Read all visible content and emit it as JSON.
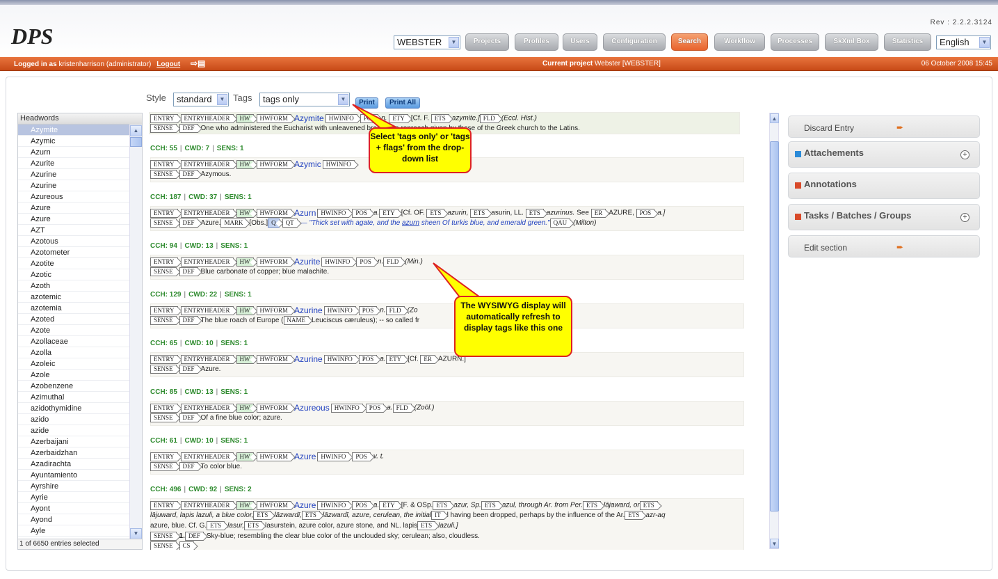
{
  "app": {
    "logo": "DPS",
    "rev": "Rev : 2.2.2.3124",
    "dictionary": "WEBSTER",
    "language": "English"
  },
  "nav": [
    "Projects",
    "Profiles",
    "Users",
    "Configuration",
    "Search",
    "Workflow",
    "Processes",
    "SkXml Box",
    "Statistics"
  ],
  "userbar": {
    "logged_label": "Logged in as",
    "user": "kristenharrison (administrator)",
    "logout": "Logout",
    "project_label": "Current project",
    "project": "Webster [WEBSTER]",
    "date": "06 October 2008 15:45"
  },
  "toolbar": {
    "style_label": "Style",
    "style_value": "standard",
    "tags_label": "Tags",
    "tags_value": "tags only",
    "print": "Print",
    "print_all": "Print All"
  },
  "headwords": {
    "title": "Headwords",
    "footer": "1 of 6650 entries selected",
    "items": [
      "Azymite",
      "Azymic",
      "Azurn",
      "Azurite",
      "Azurine",
      "Azurine",
      "Azureous",
      "Azure",
      "Azure",
      "AZT",
      "Azotous",
      "Azotometer",
      "Azotite",
      "Azotic",
      "Azoth",
      "azotemic",
      "azotemia",
      "Azoted",
      "Azote",
      "Azollaceae",
      "Azolla",
      "Azoleic",
      "Azole",
      "Azobenzene",
      "Azimuthal",
      "azidothymidine",
      "azido",
      "azide",
      "Azerbaijani",
      "Azerbaidzhan",
      "Azadirachta",
      "Ayuntamiento",
      "Ayrshire",
      "Ayrie",
      "Ayont",
      "Ayond",
      "Ayle"
    ]
  },
  "entries": [
    {
      "stats": "",
      "hw": "Azymite",
      "line1": "[Cf. F.",
      "ets": "azymite.]",
      "fld": "(Eccl. Hist.)",
      "def": "One who administered the Eucharist with unleavened bread; -- a reproach given by those of the Greek church to the Latins."
    },
    {
      "stats": [
        "CCH: 55",
        "CWD: 7",
        "SENS: 1"
      ],
      "hw": "Azymic",
      "def": "Azymous."
    },
    {
      "stats": [
        "CCH: 187",
        "CWD: 37",
        "SENS: 1"
      ],
      "hw": "Azurn",
      "pos": "a.",
      "l1a": "[Cf. OF.",
      "l1b": "azurin,",
      "l1c": "asurin, LL.",
      "l1d": "azurinus.",
      "l1e": "See",
      "l1f": "AZURE,",
      "l1g": "a.]",
      "def": "Azure.",
      "obs": "[Obs.]",
      "quote": "— \"Thick set with agate, and the",
      "quoteb": "azurn",
      "quotec": "sheen Of turkis blue, and emerald green.\"",
      "auth": "(Milton)"
    },
    {
      "stats": [
        "CCH: 94",
        "CWD: 13",
        "SENS: 1"
      ],
      "hw": "Azurite",
      "pos": "n.",
      "fld": "(Min.)",
      "def": "Blue carbonate of copper; blue malachite."
    },
    {
      "stats": [
        "CCH: 129",
        "CWD: 22",
        "SENS: 1"
      ],
      "hw": "Azurine",
      "pos": "n.",
      "fld": "(Zo",
      "def": "The blue roach of Europe (",
      "defb": "Leuciscus cæruleus); -- so called fr"
    },
    {
      "stats": [
        "CCH: 65",
        "CWD: 10",
        "SENS: 1"
      ],
      "hw": "Azurine",
      "pos": "a.",
      "l1": "[Cf.",
      "l1b": "AZURN.]",
      "def": "Azure."
    },
    {
      "stats": [
        "CCH: 85",
        "CWD: 13",
        "SENS: 1"
      ],
      "hw": "Azureous",
      "pos": "a.",
      "fld": "(Zoöl.)",
      "def": "Of a fine blue color; azure."
    },
    {
      "stats": [
        "CCH: 61",
        "CWD: 10",
        "SENS: 1"
      ],
      "hw": "Azure",
      "pos": "v. t.",
      "def": "To color blue."
    },
    {
      "stats": [
        "CCH: 496",
        "CWD: 92",
        "SENS: 2"
      ],
      "hw": "Azure",
      "pos": "a.",
      "a": "[F. & OSp.",
      "b": "azur, Sp.",
      "c": "azul, through Ar. from Per.",
      "d": "lājaward, or",
      "e": "lājuward, lapis lazuli, a blue color,",
      "f": "lāzwardī,",
      "g": "lāzwardī, azure, cerulean, the initial",
      "h": "l having been dropped, perhaps by the influence of the Ar.",
      "i": "azr-aq",
      "j": "azure, blue. Cf. G.",
      "k": "lasur,",
      "l": "lasurstein, azure color, azure stone, and NL. lapis",
      "m": "lazuli.]",
      "n": "1.",
      "o": "Sky-blue; resembling the clear blue color of the unclouded sky; cerulean; also, cloudless."
    }
  ],
  "tags": {
    "entry": "ENTRY",
    "entryheader": "ENTRYHEADER",
    "hw": "HW",
    "hwform": "HWFORM",
    "hwinfo": "HWINFO",
    "pos": "POS",
    "ety": "ETY",
    "ets": "ETS",
    "fld": "FLD",
    "sense": "SENSE",
    "def": "DEF",
    "mark": "MARK",
    "q": "Q",
    "qt": "QT",
    "qau": "QAU",
    "er": "ER",
    "name": "NAME",
    "it": "IT",
    "cs": "CS"
  },
  "right": {
    "discard": "Discard Entry",
    "attach": "Attachements",
    "annot": "Annotations",
    "tasks": "Tasks / Batches / Groups",
    "edit": "Edit section"
  },
  "callouts": {
    "one": "Select 'tags only' or 'tags + flags' from the drop-down list",
    "two": "The WYSIWYG display will automatically refresh to display tags like this one"
  },
  "colors": {
    "orange": "#d85a22",
    "callout_fill": "#ffff00",
    "callout_border": "#dd2222"
  }
}
